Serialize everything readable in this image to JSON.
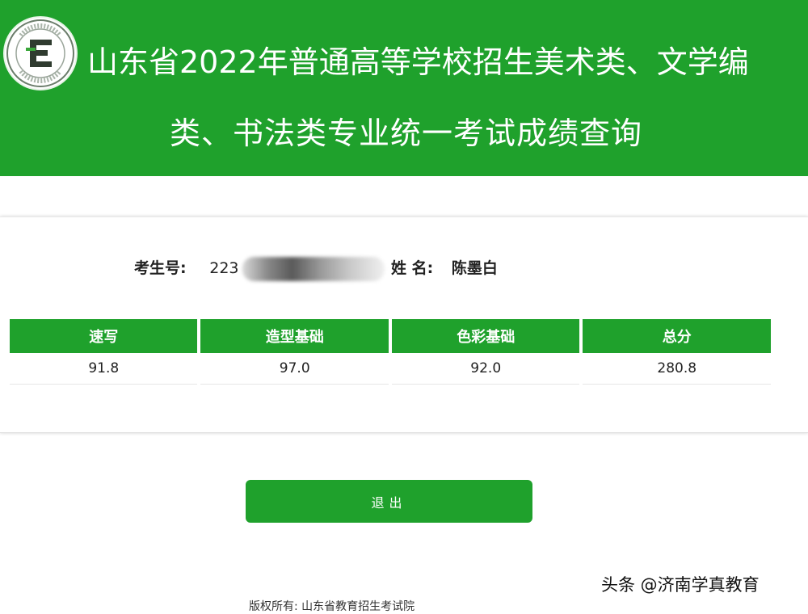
{
  "header": {
    "title_line1": "山东省2022年普通高等学校招生美术类、文学编",
    "title_line2": "类、书法类专业统一考试成绩查询",
    "background_color": "#1fa12c",
    "logo_icon": "exam-authority-seal-icon"
  },
  "candidate": {
    "id_label": "考生号:",
    "id_value_visible": "223",
    "name_label": "姓 名:",
    "name_value": "陈墨白"
  },
  "scores": {
    "headers": [
      "速写",
      "造型基础",
      "色彩基础",
      "总分"
    ],
    "values": [
      "91.8",
      "97.0",
      "92.0",
      "280.8"
    ]
  },
  "actions": {
    "exit_label": "退出",
    "accent_color": "#1fa12c"
  },
  "footer": {
    "copyright": "版权所有:  山东省教育招生考试院"
  },
  "watermark": {
    "text": "头条 @济南学真教育"
  }
}
